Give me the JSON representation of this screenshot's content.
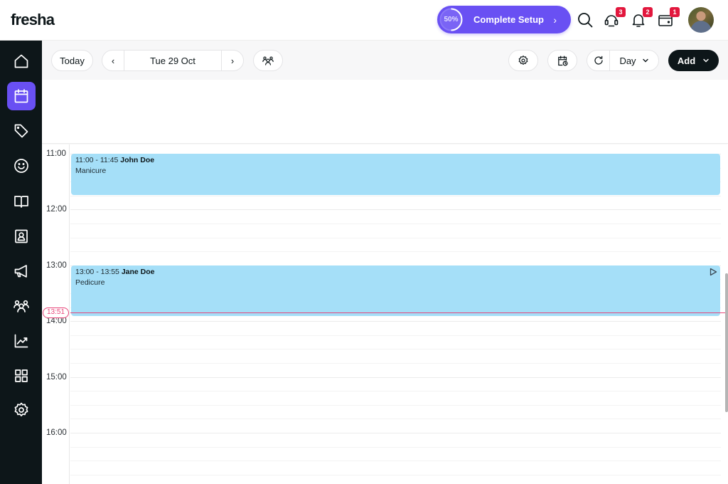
{
  "app": {
    "logo": "fresha"
  },
  "topbar": {
    "setup": {
      "percent_label": "50%",
      "progress": 0.5,
      "label": "Complete Setup",
      "chevron": "›"
    },
    "icons": [
      {
        "name": "search-icon"
      },
      {
        "name": "support-icon",
        "badge": "3"
      },
      {
        "name": "notifications-icon",
        "badge": "2"
      },
      {
        "name": "wallet-icon",
        "badge": "1"
      }
    ]
  },
  "sidebar": {
    "items": [
      {
        "name": "home",
        "icon": "home-icon",
        "active": false
      },
      {
        "name": "calendar",
        "icon": "calendar-icon",
        "active": true
      },
      {
        "name": "sales",
        "icon": "tag-icon",
        "active": false
      },
      {
        "name": "clients",
        "icon": "smiley-icon",
        "active": false
      },
      {
        "name": "catalog",
        "icon": "book-icon",
        "active": false
      },
      {
        "name": "team",
        "icon": "contact-card-icon",
        "active": false
      },
      {
        "name": "marketing",
        "icon": "megaphone-icon",
        "active": false
      },
      {
        "name": "people",
        "icon": "group-icon",
        "active": false
      },
      {
        "name": "reports",
        "icon": "chart-icon",
        "active": false
      },
      {
        "name": "apps",
        "icon": "grid-icon",
        "active": false
      },
      {
        "name": "settings",
        "icon": "settings-icon",
        "active": false
      }
    ]
  },
  "toolbar": {
    "today_label": "Today",
    "prev_label": "‹",
    "date_label": "Tue 29 Oct",
    "next_label": "›",
    "view_label": "Day",
    "add_label": "Add"
  },
  "calendar": {
    "hours": [
      "11:00",
      "12:00",
      "13:00",
      "14:00",
      "15:00",
      "16:00"
    ],
    "current_time": "13:51",
    "appointments": [
      {
        "time": "11:00 - 11:45",
        "client": "John Doe",
        "service": "Manicure",
        "start": "11:00",
        "end": "11:45"
      },
      {
        "time": "13:00 - 13:55",
        "client": "Jane Doe",
        "service": "Pedicure",
        "start": "13:00",
        "end": "13:55"
      }
    ]
  },
  "colors": {
    "brand": "#6950f3",
    "sidebar_bg": "#0d1619",
    "appointment": "#a5dff8",
    "now_line": "#e8477a",
    "badge": "#e2173d"
  }
}
